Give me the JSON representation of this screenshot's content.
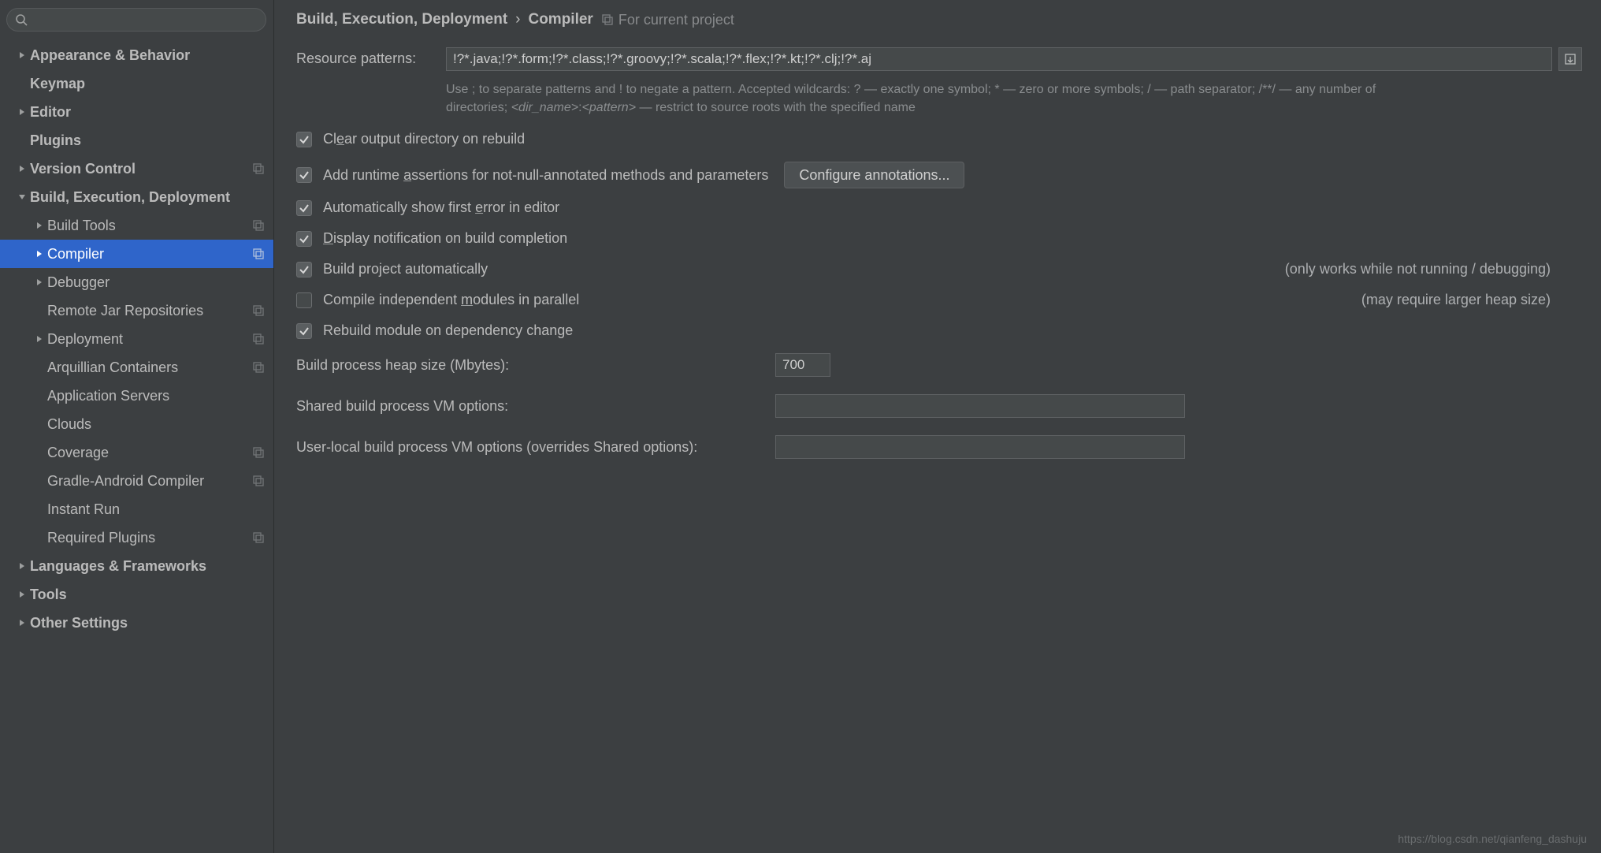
{
  "sidebar": {
    "search_placeholder": "",
    "items": [
      {
        "label": "Appearance & Behavior",
        "indent": 0,
        "arrow": "right",
        "bold": true,
        "badge": false,
        "selected": false
      },
      {
        "label": "Keymap",
        "indent": 0,
        "arrow": "none",
        "bold": true,
        "badge": false,
        "selected": false
      },
      {
        "label": "Editor",
        "indent": 0,
        "arrow": "right",
        "bold": true,
        "badge": false,
        "selected": false
      },
      {
        "label": "Plugins",
        "indent": 0,
        "arrow": "none",
        "bold": true,
        "badge": false,
        "selected": false
      },
      {
        "label": "Version Control",
        "indent": 0,
        "arrow": "right",
        "bold": true,
        "badge": true,
        "selected": false
      },
      {
        "label": "Build, Execution, Deployment",
        "indent": 0,
        "arrow": "down",
        "bold": true,
        "badge": false,
        "selected": false
      },
      {
        "label": "Build Tools",
        "indent": 1,
        "arrow": "right",
        "bold": false,
        "badge": true,
        "selected": false
      },
      {
        "label": "Compiler",
        "indent": 1,
        "arrow": "right",
        "bold": false,
        "badge": true,
        "selected": true
      },
      {
        "label": "Debugger",
        "indent": 1,
        "arrow": "right",
        "bold": false,
        "badge": false,
        "selected": false
      },
      {
        "label": "Remote Jar Repositories",
        "indent": 1,
        "arrow": "none",
        "bold": false,
        "badge": true,
        "selected": false
      },
      {
        "label": "Deployment",
        "indent": 1,
        "arrow": "right",
        "bold": false,
        "badge": true,
        "selected": false
      },
      {
        "label": "Arquillian Containers",
        "indent": 1,
        "arrow": "none",
        "bold": false,
        "badge": true,
        "selected": false
      },
      {
        "label": "Application Servers",
        "indent": 1,
        "arrow": "none",
        "bold": false,
        "badge": false,
        "selected": false
      },
      {
        "label": "Clouds",
        "indent": 1,
        "arrow": "none",
        "bold": false,
        "badge": false,
        "selected": false
      },
      {
        "label": "Coverage",
        "indent": 1,
        "arrow": "none",
        "bold": false,
        "badge": true,
        "selected": false
      },
      {
        "label": "Gradle-Android Compiler",
        "indent": 1,
        "arrow": "none",
        "bold": false,
        "badge": true,
        "selected": false
      },
      {
        "label": "Instant Run",
        "indent": 1,
        "arrow": "none",
        "bold": false,
        "badge": false,
        "selected": false
      },
      {
        "label": "Required Plugins",
        "indent": 1,
        "arrow": "none",
        "bold": false,
        "badge": true,
        "selected": false
      },
      {
        "label": "Languages & Frameworks",
        "indent": 0,
        "arrow": "right",
        "bold": true,
        "badge": false,
        "selected": false
      },
      {
        "label": "Tools",
        "indent": 0,
        "arrow": "right",
        "bold": true,
        "badge": false,
        "selected": false
      },
      {
        "label": "Other Settings",
        "indent": 0,
        "arrow": "right",
        "bold": true,
        "badge": false,
        "selected": false
      }
    ]
  },
  "breadcrumb": {
    "part1": "Build, Execution, Deployment",
    "sep": "›",
    "part2": "Compiler",
    "scope": "For current project"
  },
  "resource": {
    "label": "Resource patterns:",
    "value": "!?*.java;!?*.form;!?*.class;!?*.groovy;!?*.scala;!?*.flex;!?*.kt;!?*.clj;!?*.aj",
    "help_plain_1": "Use ; to separate patterns and ! to negate a pattern. Accepted wildcards: ? — exactly one symbol; * — zero or more symbols; / — path separator; /**/ — any number of directories; ",
    "help_i1": "<dir_name>",
    "help_colon": ":",
    "help_i2": "<pattern>",
    "help_plain_2": " — restrict to source roots with the specified name"
  },
  "checks": {
    "clear_output": {
      "label_pre": "Cl",
      "label_u": "e",
      "label_post": "ar output directory on rebuild",
      "checked": true
    },
    "assertions": {
      "label_pre": "Add runtime ",
      "label_u": "a",
      "label_post": "ssertions for not-null-annotated methods and parameters",
      "checked": true
    },
    "config_btn": "Configure annotations...",
    "first_error": {
      "label_pre": "Automatically show first ",
      "label_u": "e",
      "label_post": "rror in editor",
      "checked": true
    },
    "notify": {
      "label_pre": "",
      "label_u": "D",
      "label_post": "isplay notification on build completion",
      "checked": true
    },
    "auto_build": {
      "label_pre": "Build project automatically",
      "label_u": "",
      "label_post": "",
      "checked": true,
      "aux": "(only works while not running / debugging)"
    },
    "parallel": {
      "label_pre": "Compile independent ",
      "label_u": "m",
      "label_post": "odules in parallel",
      "checked": false,
      "aux": "(may require larger heap size)"
    },
    "rebuild_dep": {
      "label_pre": "Rebuild module on dependency change",
      "label_u": "",
      "label_post": "",
      "checked": true
    }
  },
  "kv": {
    "heap": {
      "label": "Build process heap size (Mbytes):",
      "value": "700"
    },
    "shared_vm": {
      "label": "Shared build process VM options:",
      "value": ""
    },
    "user_vm": {
      "label": "User-local build process VM options (overrides Shared options):",
      "value": ""
    }
  },
  "watermark": "https://blog.csdn.net/qianfeng_dashuju"
}
